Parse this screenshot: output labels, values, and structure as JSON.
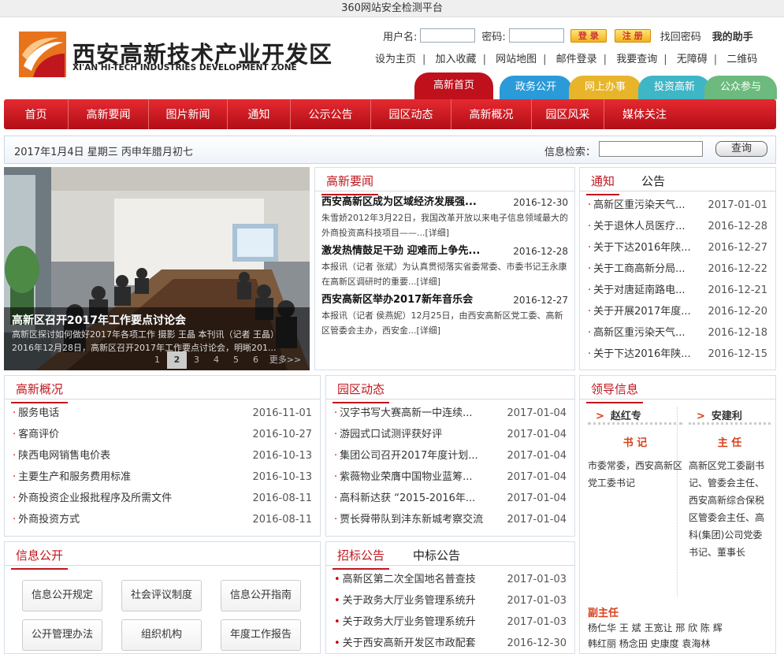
{
  "topbar": {
    "text": "360网站安全检测平台"
  },
  "logo": {
    "cn": "西安高新技术产业开发区",
    "en": "XI'AN HI-TECH INDUSTRIES DEVELOPMENT ZONE"
  },
  "login": {
    "username_label": "用户名:",
    "password_label": "密码:",
    "login_btn": "登 录",
    "register_btn": "注 册",
    "find_pwd": "找回密码",
    "assistant": "我的助手"
  },
  "links": [
    "设为主页",
    "加入收藏",
    "网站地图",
    "邮件登录",
    "我要查询",
    "无障碍",
    "二维码"
  ],
  "tabs": [
    "高新首页",
    "政务公开",
    "网上办事",
    "投资高新",
    "公众参与"
  ],
  "nav": [
    "首页",
    "高新要闻",
    "图片新闻",
    "通知",
    "公示公告",
    "园区动态",
    "高新概况",
    "园区风采",
    "媒体关注"
  ],
  "datebar": {
    "date": "2017年1月4日  星期三  丙申年腊月初七",
    "search_label": "信息检索：",
    "search_btn": "查询"
  },
  "slide": {
    "title": "高新区召开2017年工作要点讨论会",
    "desc1": "高新区探讨如何做好2017年各项工作 摄影 王晶 本刊讯（记者 王晶）",
    "desc2": "2016年12月28日，高新区召开2017年工作要点讨论会，明晰201...",
    "pages": [
      "1",
      "2",
      "3",
      "4",
      "5",
      "6",
      "更多>>"
    ]
  },
  "news": {
    "title": "高新要闻",
    "items": [
      {
        "title": "西安高新区成为区域经济发展强...",
        "date": "2016-12-30",
        "desc": "朱雪娇2012年3月22日，我国改革开放以来电子信息领域最大的外商投资高科技项目——...[详细]"
      },
      {
        "title": "激发热情鼓足干劲 迎难而上争先...",
        "date": "2016-12-28",
        "desc": "本报讯（记者 张斌）为认真贯彻落实省委常委、市委书记王永康在高新区调研时的重要...[详细]"
      },
      {
        "title": "西安高新区举办2017新年音乐会",
        "date": "2016-12-27",
        "desc": "本报讯（记者 侯燕妮）12月25日，由西安高新区党工委、高新区管委会主办，西安金...[详细]"
      }
    ]
  },
  "notice": {
    "tab1": "通知",
    "tab2": "公告",
    "items": [
      {
        "t": "高新区重污染天气...",
        "d": "2017-01-01"
      },
      {
        "t": "关于退休人员医疗...",
        "d": "2016-12-28"
      },
      {
        "t": "关于下达2016年陕...",
        "d": "2016-12-27"
      },
      {
        "t": "关于工商高新分局...",
        "d": "2016-12-22"
      },
      {
        "t": "关于对唐延南路电...",
        "d": "2016-12-21"
      },
      {
        "t": "关于开展2017年度...",
        "d": "2016-12-20"
      },
      {
        "t": "高新区重污染天气...",
        "d": "2016-12-18"
      },
      {
        "t": "关于下达2016年陕...",
        "d": "2016-12-15"
      }
    ]
  },
  "overview": {
    "title": "高新概况",
    "items": [
      {
        "t": "服务电话",
        "d": "2016-11-01"
      },
      {
        "t": "客商评价",
        "d": "2016-10-27"
      },
      {
        "t": "陕西电网销售电价表",
        "d": "2016-10-13"
      },
      {
        "t": "主要生产和服务费用标准",
        "d": "2016-10-13"
      },
      {
        "t": "外商投资企业报批程序及所需文件",
        "d": "2016-08-11"
      },
      {
        "t": "外商投资方式",
        "d": "2016-08-11"
      }
    ]
  },
  "park": {
    "title": "园区动态",
    "items": [
      {
        "t": "汉字书写大赛高新一中连续...",
        "d": "2017-01-04"
      },
      {
        "t": "游园式口试测评获好评",
        "d": "2017-01-04"
      },
      {
        "t": "集团公司召开2017年度计划...",
        "d": "2017-01-04"
      },
      {
        "t": "紫薇物业荣膺中国物业蓝筹...",
        "d": "2017-01-04"
      },
      {
        "t": "高科新达获 “2015-2016年...",
        "d": "2017-01-04"
      },
      {
        "t": "贾长舜带队到沣东新城考察交流",
        "d": "2017-01-04"
      }
    ]
  },
  "leader": {
    "title": "领导信息",
    "l1": {
      "name": "赵红专",
      "role": "书 记",
      "desc": "市委常委，西安高新区党工委书记"
    },
    "l2": {
      "name": "安建利",
      "role": "主 任",
      "desc": "高新区党工委副书记、管委会主任、西安高新综合保税区管委会主任、高科(集团)公司党委书记、董事长"
    },
    "deputy_label": "副主任",
    "deputy1": "杨仁华  王 斌  王宽让  邢 欣  陈 辉",
    "deputy2": "韩红丽  杨念田  史康度  袁海林"
  },
  "info": {
    "title": "信息公开",
    "buttons": [
      "信息公开规定",
      "社会评议制度",
      "信息公开指南",
      "公开管理办法",
      "组织机构",
      "年度工作报告"
    ]
  },
  "bid": {
    "tab1": "招标公告",
    "tab2": "中标公告",
    "items": [
      {
        "t": "高新区第二次全国地名普查技",
        "d": "2017-01-03"
      },
      {
        "t": "关于政务大厅业务管理系统升",
        "d": "2017-01-03"
      },
      {
        "t": "关于政务大厅业务管理系统升",
        "d": "2017-01-03"
      },
      {
        "t": "关于西安高新开发区市政配套",
        "d": "2016-12-30"
      }
    ]
  },
  "colors": {
    "brand_red": "#c0161e",
    "nav_red": "#d21c24",
    "tab_blue": "#2b9ad8",
    "tab_yellow": "#e7b42a",
    "tab_cyan": "#3eb6c6",
    "tab_green": "#6cba7d"
  }
}
